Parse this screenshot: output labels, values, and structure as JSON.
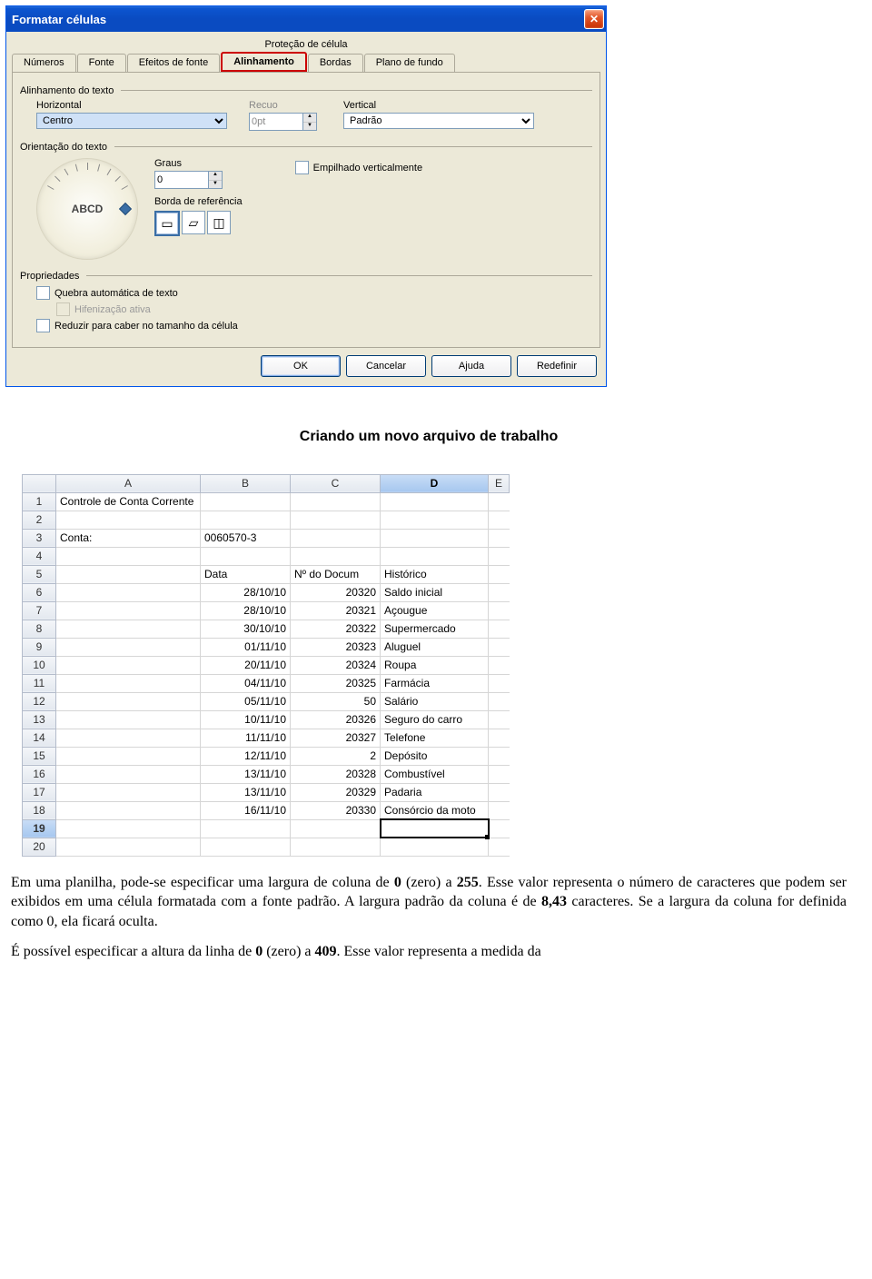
{
  "dialog": {
    "title": "Formatar células",
    "upperTabLabel": "Proteção de célula",
    "tabs": [
      "Números",
      "Fonte",
      "Efeitos de fonte",
      "Alinhamento",
      "Bordas",
      "Plano de fundo"
    ],
    "activeTab": "Alinhamento",
    "textAlign": {
      "groupTitle": "Alinhamento do texto",
      "horizontalLabel": "Horizontal",
      "horizontalValue": "Centro",
      "indentLabel": "Recuo",
      "indentValue": "0pt",
      "verticalLabel": "Vertical",
      "verticalValue": "Padrão"
    },
    "orientation": {
      "groupTitle": "Orientação do texto",
      "dialText": "ABCD",
      "degreesLabel": "Graus",
      "degreesValue": "0",
      "refLabel": "Borda de referência",
      "stackedLabel": "Empilhado verticalmente"
    },
    "properties": {
      "groupTitle": "Propriedades",
      "wrap": "Quebra automática de texto",
      "hyphen": "Hifenização ativa",
      "shrink": "Reduzir para caber no tamanho da célula"
    },
    "buttons": {
      "ok": "OK",
      "cancel": "Cancelar",
      "help": "Ajuda",
      "reset": "Redefinir"
    }
  },
  "doc": {
    "heading": "Criando um novo arquivo de trabalho",
    "p1a": "Em uma planilha, pode-se especificar uma largura de coluna de ",
    "p1b": "0",
    "p1c": " (zero) a ",
    "p1d": "255",
    "p1e": ". Esse valor representa o número de caracteres que podem ser exibidos em uma célula formatada com a fonte padrão. A largura padrão da coluna é de ",
    "p1f": "8,43",
    "p1g": " caracteres. Se a largura da coluna for definida como 0, ela ficará oculta.",
    "p2a": "É possível especificar a altura da linha de ",
    "p2b": "0",
    "p2c": " (zero) a ",
    "p2d": "409",
    "p2e": ". Esse valor representa a medida da"
  },
  "sheet": {
    "columns": [
      "A",
      "B",
      "C",
      "D",
      "E"
    ],
    "selectedCol": "D",
    "selectedRow": 19,
    "rows": [
      {
        "n": 1,
        "A": "Controle de Conta Corrente"
      },
      {
        "n": 2
      },
      {
        "n": 3,
        "A": "Conta:",
        "B": "0060570-3"
      },
      {
        "n": 4
      },
      {
        "n": 5,
        "B": "Data",
        "C": "Nº do Docum",
        "D": "Histórico"
      },
      {
        "n": 6,
        "B": "28/10/10",
        "C": "20320",
        "D": "Saldo inicial"
      },
      {
        "n": 7,
        "B": "28/10/10",
        "C": "20321",
        "D": "Açougue"
      },
      {
        "n": 8,
        "B": "30/10/10",
        "C": "20322",
        "D": "Supermercado"
      },
      {
        "n": 9,
        "B": "01/11/10",
        "C": "20323",
        "D": "Aluguel"
      },
      {
        "n": 10,
        "B": "20/11/10",
        "C": "20324",
        "D": "Roupa"
      },
      {
        "n": 11,
        "B": "04/11/10",
        "C": "20325",
        "D": "Farmácia"
      },
      {
        "n": 12,
        "B": "05/11/10",
        "C": "50",
        "D": "Salário"
      },
      {
        "n": 13,
        "B": "10/11/10",
        "C": "20326",
        "D": "Seguro do carro"
      },
      {
        "n": 14,
        "B": "11/11/10",
        "C": "20327",
        "D": "Telefone"
      },
      {
        "n": 15,
        "B": "12/11/10",
        "C": "2",
        "D": "Depósito"
      },
      {
        "n": 16,
        "B": "13/11/10",
        "C": "20328",
        "D": "Combustível"
      },
      {
        "n": 17,
        "B": "13/11/10",
        "C": "20329",
        "D": "Padaria"
      },
      {
        "n": 18,
        "B": "16/11/10",
        "C": "20330",
        "D": "Consórcio da moto"
      },
      {
        "n": 19
      },
      {
        "n": 20
      }
    ]
  }
}
